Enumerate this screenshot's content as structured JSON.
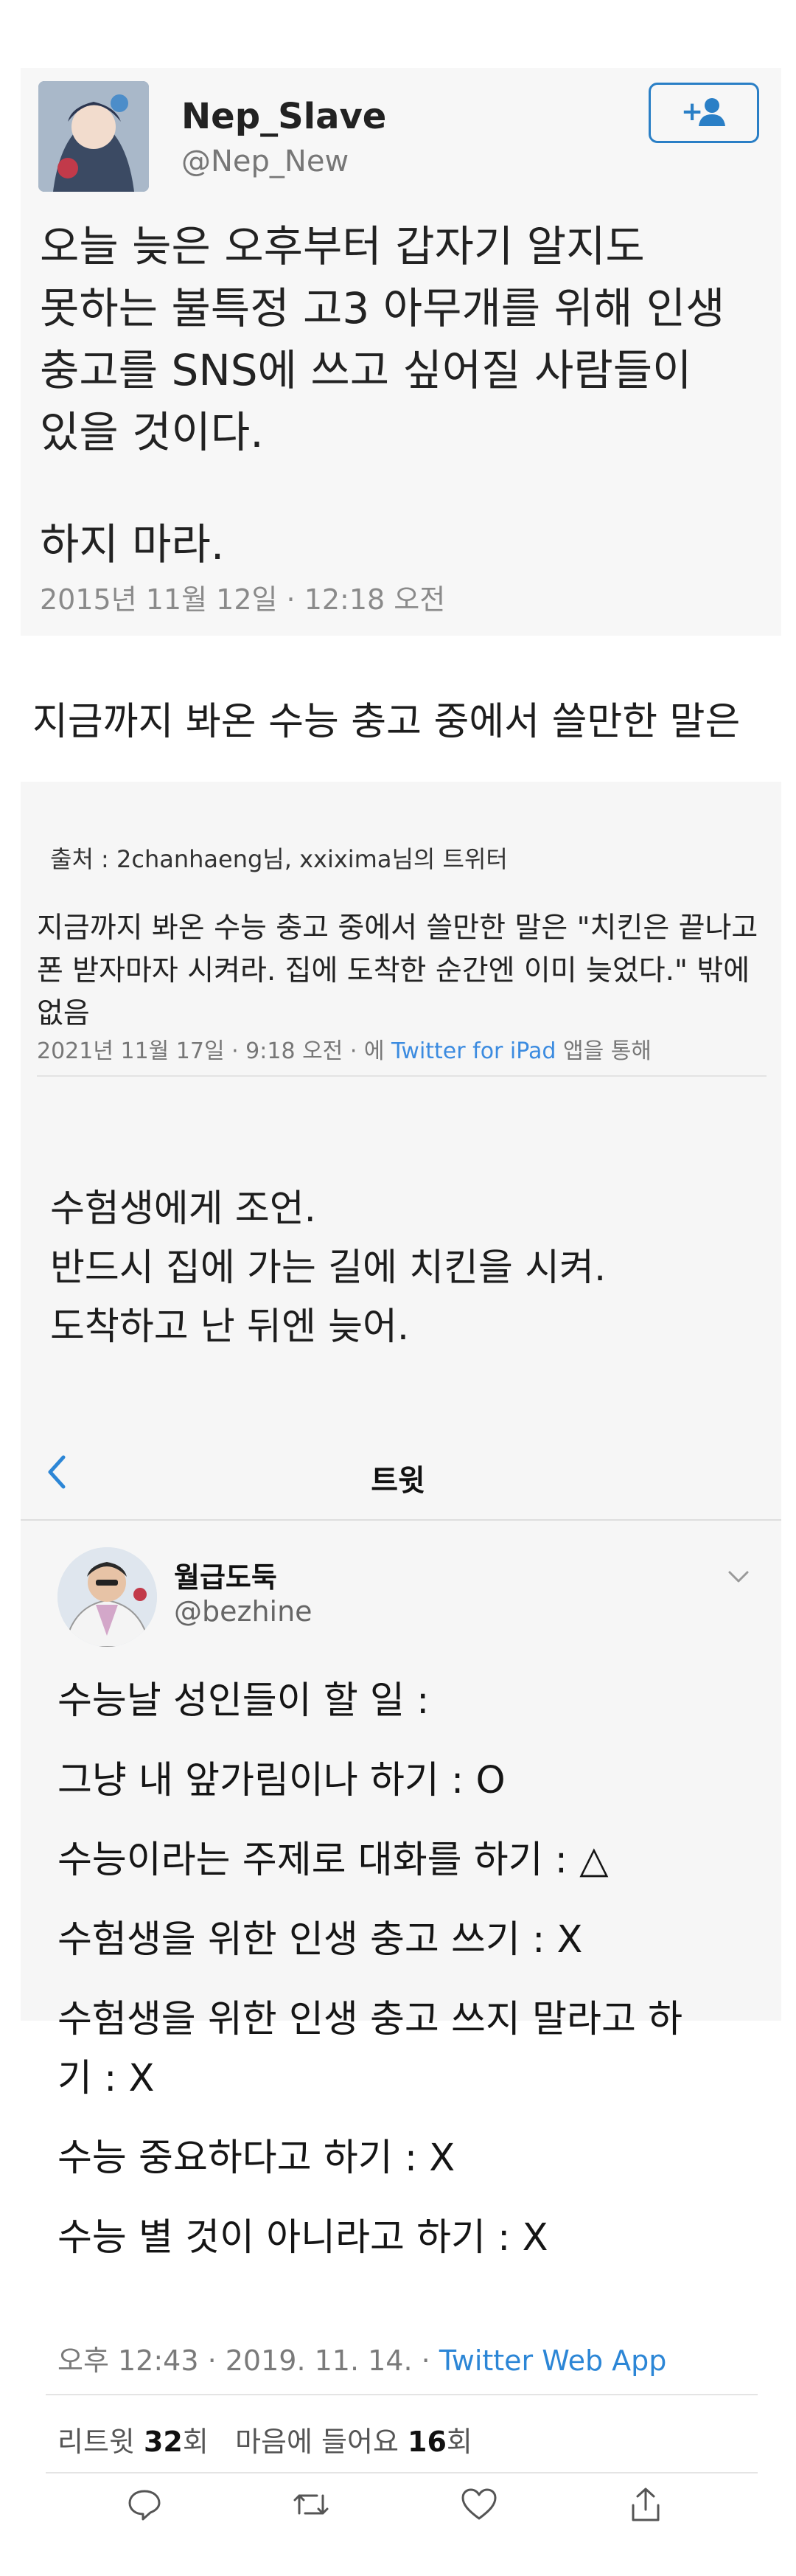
{
  "tweet1": {
    "name": "Nep_Slave",
    "handle": "@Nep_New",
    "body_lines": [
      "오늘 늦은 오후부터 갑자기 알지도",
      "못하는 불특정 고3 아무개를 위해 인생",
      "충고를 SNS에 쓰고 싶어질 사람들이",
      "있을 것이다."
    ],
    "body_last": "하지 마라.",
    "date": "2015년 11월 12일 · 12:18 오전"
  },
  "heading": "지금까지 봐온 수능 충고 중에서 쓸만한 말은",
  "tweet2": {
    "source": "출처 : 2chanhaeng님, xxixima님의 트위터",
    "body": "지금까지 봐온 수능 충고 중에서 쓸만한 말은 \"치킨은 끝나고 폰 받자마자 시켜라. 집에 도착한 순간엔 이미 늦었다.\" 밖에 없음",
    "meta_prefix": "2021년 11월 17일 · 9:18 오전 · 에",
    "meta_app": "Twitter for iPad",
    "meta_suffix": "앱을 통해"
  },
  "advice": [
    "수험생에게 조언.",
    "반드시 집에 가는 길에 치킨을 시켜.",
    "도착하고 난 뒤엔 늦어."
  ],
  "tweet3": {
    "screen_title": "트윗",
    "name": "월급도둑",
    "handle": "@bezhine",
    "lines": [
      "수능날 성인들이 할 일 :",
      "그냥 내 앞가림이나 하기 : O",
      "수능이라는 주제로 대화를 하기 : △",
      "수험생을 위한 인생 충고 쓰기 : X",
      "수험생을 위한 인생 충고 쓰지 말라고 하",
      "기 : X",
      "수능 중요하다고 하기 : X",
      "수능 별 것이 아니라고 하기 : X"
    ],
    "meta_time": "오후 12:43 · 2019. 11. 14. ·",
    "meta_app": "Twitter Web App",
    "retweet_label": "리트윗",
    "retweet_count": "32",
    "retweet_unit": "회",
    "like_label": "마음에 들어요",
    "like_count": "16",
    "like_unit": "회"
  },
  "icons": {
    "back": "chevron-left-icon",
    "follow": "add-user-icon",
    "caret": "chevron-down-icon",
    "actions": [
      "reply-icon",
      "retweet-icon",
      "like-icon",
      "share-icon"
    ]
  },
  "colors": {
    "link_blue": "#2c86d6",
    "follow_blue": "#2a7fc6",
    "card_bg": "#f7f7f7"
  }
}
